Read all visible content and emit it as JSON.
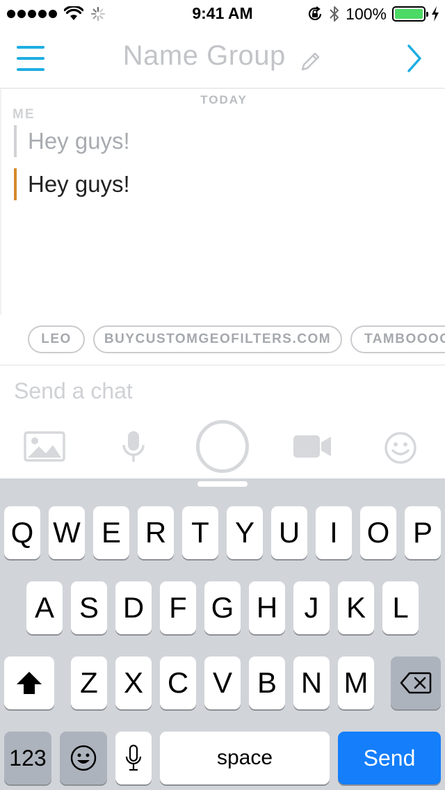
{
  "status_bar": {
    "time": "9:41 AM",
    "battery_percent": "100%",
    "signal_bars": 5,
    "icons": [
      "wifi-icon",
      "loading-spinner-icon",
      "rotation-lock-icon",
      "bluetooth-icon",
      "battery-icon"
    ]
  },
  "header": {
    "title": "Name Group",
    "icons": [
      "menu-icon",
      "pencil-icon",
      "chevron-right-icon"
    ],
    "accent_color": "#1daee2"
  },
  "chat": {
    "date_label": "TODAY",
    "sender_label": "ME",
    "messages": [
      {
        "text": "Hey guys!",
        "state": "pending",
        "bar_color": "#d0d2d5"
      },
      {
        "text": "Hey guys!",
        "state": "sent",
        "bar_color": "#d48a2c"
      }
    ]
  },
  "suggestions": [
    "LEO",
    "BUYCUSTOMGEOFILTERS.COM",
    "TAMBOOOO"
  ],
  "composer": {
    "placeholder": "Send a chat",
    "tools": [
      "photo-icon",
      "microphone-icon",
      "capture-button",
      "video-camera-icon",
      "emoji-icon"
    ]
  },
  "keyboard": {
    "row1": [
      "Q",
      "W",
      "E",
      "R",
      "T",
      "Y",
      "U",
      "I",
      "O",
      "P"
    ],
    "row2": [
      "A",
      "S",
      "D",
      "F",
      "G",
      "H",
      "J",
      "K",
      "L"
    ],
    "row3": [
      "Z",
      "X",
      "C",
      "V",
      "B",
      "N",
      "M"
    ],
    "numbers_label": "123",
    "space_label": "space",
    "send_label": "Send",
    "send_color": "#147efb"
  }
}
